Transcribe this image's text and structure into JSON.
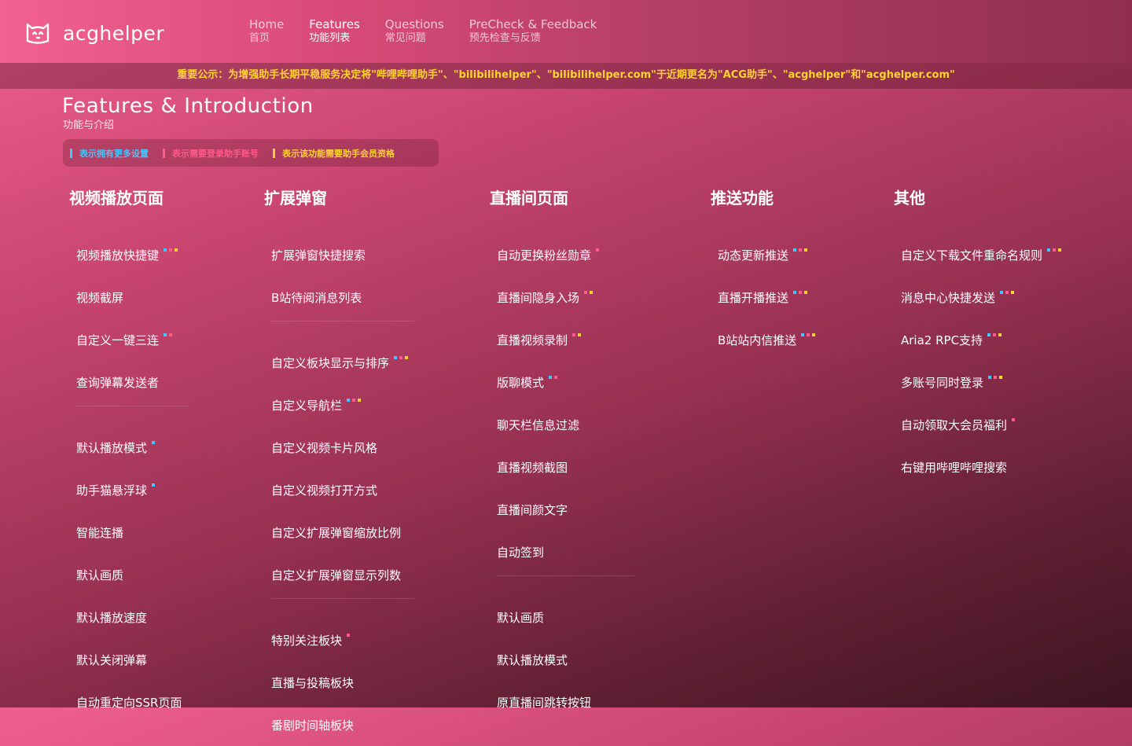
{
  "brand": {
    "name": "acghelper"
  },
  "colors": {
    "settings": "#3fc8ff",
    "login": "#ff5a8a",
    "vip": "#ffd52b",
    "notice": "#ffd52b"
  },
  "nav": [
    {
      "en": "Home",
      "zh": "首页",
      "active": false
    },
    {
      "en": "Features",
      "zh": "功能列表",
      "active": true
    },
    {
      "en": "Questions",
      "zh": "常见问题",
      "active": false
    },
    {
      "en": "PreCheck & Feedback",
      "zh": "预先检查与反馈",
      "active": false
    }
  ],
  "notice": "重要公示：为增强助手长期平稳服务决定将\"哔哩哔哩助手\"、\"bilibilihelper\"、\"bilibilihelper.com\"于近期更名为\"ACG助手\"、\"acghelper\"和\"acghelper.com\"",
  "page": {
    "title": "Features & Introduction",
    "subtitle": "功能与介绍"
  },
  "legend": [
    {
      "text": "表示拥有更多设置",
      "color": "#3fc8ff"
    },
    {
      "text": "表示需要登录助手账号",
      "color": "#ff5a8a"
    },
    {
      "text": "表示该功能需要助手会员资格",
      "color": "#ffd52b"
    }
  ],
  "columns": [
    {
      "title": "视频播放页面",
      "groups": [
        [
          {
            "label": "视频播放快捷键",
            "marks": [
              "settings",
              "login",
              "vip"
            ]
          },
          {
            "label": "视频截屏",
            "marks": []
          },
          {
            "label": "自定义一键三连",
            "marks": [
              "settings",
              "login"
            ]
          },
          {
            "label": "查询弹幕发送者",
            "marks": []
          }
        ],
        [
          {
            "label": "默认播放模式",
            "marks": [
              "settings"
            ]
          },
          {
            "label": "助手猫悬浮球",
            "marks": [
              "settings"
            ]
          },
          {
            "label": "智能连播",
            "marks": []
          },
          {
            "label": "默认画质",
            "marks": []
          },
          {
            "label": "默认播放速度",
            "marks": []
          },
          {
            "label": "默认关闭弹幕",
            "marks": []
          },
          {
            "label": "自动重定向SSR页面",
            "marks": []
          }
        ]
      ]
    },
    {
      "title": "扩展弹窗",
      "groups": [
        [
          {
            "label": "扩展弹窗快捷搜索",
            "marks": []
          },
          {
            "label": "B站待阅消息列表",
            "marks": []
          }
        ],
        [
          {
            "label": "自定义板块显示与排序",
            "marks": [
              "settings",
              "login",
              "vip"
            ]
          },
          {
            "label": "自定义导航栏",
            "marks": [
              "settings",
              "login",
              "vip"
            ]
          },
          {
            "label": "自定义视频卡片风格",
            "marks": []
          },
          {
            "label": "自定义视频打开方式",
            "marks": []
          },
          {
            "label": "自定义扩展弹窗缩放比例",
            "marks": []
          },
          {
            "label": "自定义扩展弹窗显示列数",
            "marks": []
          }
        ],
        [
          {
            "label": "特别关注板块",
            "marks": [
              "login"
            ]
          },
          {
            "label": "直播与投稿板块",
            "marks": []
          },
          {
            "label": "番剧时间轴板块",
            "marks": []
          }
        ]
      ]
    },
    {
      "title": "直播间页面",
      "groups": [
        [
          {
            "label": "自动更换粉丝勋章",
            "marks": [
              "login"
            ]
          },
          {
            "label": "直播间隐身入场",
            "marks": [
              "login",
              "vip"
            ]
          },
          {
            "label": "直播视频录制",
            "marks": [
              "login",
              "vip"
            ]
          },
          {
            "label": "版聊模式",
            "marks": [
              "settings",
              "login"
            ]
          },
          {
            "label": "聊天栏信息过滤",
            "marks": []
          },
          {
            "label": "直播视频截图",
            "marks": []
          },
          {
            "label": "直播间颜文字",
            "marks": []
          },
          {
            "label": "自动签到",
            "marks": []
          }
        ],
        [
          {
            "label": "默认画质",
            "marks": []
          },
          {
            "label": "默认播放模式",
            "marks": []
          },
          {
            "label": "原直播间跳转按钮",
            "marks": []
          }
        ]
      ]
    },
    {
      "title": "推送功能",
      "groups": [
        [
          {
            "label": "动态更新推送",
            "marks": [
              "settings",
              "login",
              "vip"
            ]
          },
          {
            "label": "直播开播推送",
            "marks": [
              "settings",
              "login",
              "vip"
            ]
          },
          {
            "label": "B站站内信推送",
            "marks": [
              "settings",
              "login",
              "vip"
            ]
          }
        ]
      ]
    },
    {
      "title": "其他",
      "groups": [
        [
          {
            "label": "自定义下载文件重命名规则",
            "marks": [
              "settings",
              "login",
              "vip"
            ]
          },
          {
            "label": "消息中心快捷发送",
            "marks": [
              "settings",
              "login",
              "vip"
            ]
          },
          {
            "label": "Aria2 RPC支持",
            "marks": [
              "settings",
              "login",
              "vip"
            ]
          },
          {
            "label": "多账号同时登录",
            "marks": [
              "settings",
              "login",
              "vip"
            ]
          },
          {
            "label": "自动领取大会员福利",
            "marks": [
              "login"
            ]
          },
          {
            "label": "右键用哔哩哔哩搜索",
            "marks": []
          }
        ]
      ]
    }
  ]
}
